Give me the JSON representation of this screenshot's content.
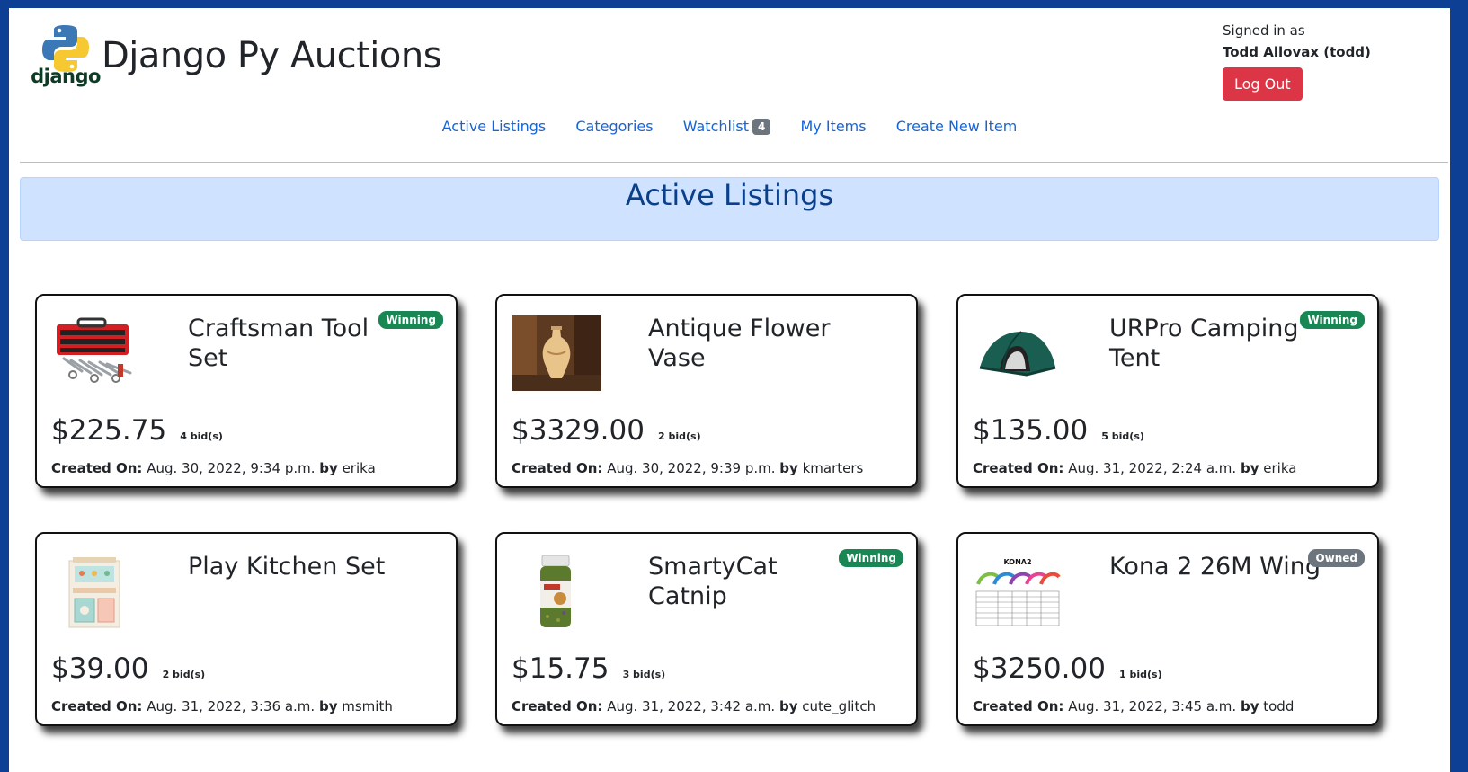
{
  "site": {
    "title": "Django Py Auctions",
    "logo_text": "django"
  },
  "user": {
    "signed_in_label": "Signed in as",
    "name": "Todd Allovax (todd)",
    "logout_label": "Log Out"
  },
  "nav": {
    "active_listings": "Active Listings",
    "categories": "Categories",
    "watchlist": "Watchlist",
    "watchlist_count": "4",
    "my_items": "My Items",
    "create_new_item": "Create New Item"
  },
  "banner": {
    "title": "Active Listings"
  },
  "labels": {
    "created_on": "Created On:",
    "by": "by"
  },
  "listings": [
    {
      "title": "Craftsman Tool Set",
      "badge": "Winning",
      "price": "$225.75",
      "bids": "4 bid(s)",
      "created": "Aug. 30, 2022, 9:34 p.m.",
      "author": "erika",
      "image": "toolbox-image"
    },
    {
      "title": "Antique Flower Vase",
      "badge": "",
      "price": "$3329.00",
      "bids": "2 bid(s)",
      "created": "Aug. 30, 2022, 9:39 p.m.",
      "author": "kmarters",
      "image": "vase-image"
    },
    {
      "title": "URPro Camping Tent",
      "badge": "Winning",
      "price": "$135.00",
      "bids": "5 bid(s)",
      "created": "Aug. 31, 2022, 2:24 a.m.",
      "author": "erika",
      "image": "tent-image"
    },
    {
      "title": "Play Kitchen Set",
      "badge": "",
      "price": "$39.00",
      "bids": "2 bid(s)",
      "created": "Aug. 31, 2022, 3:36 a.m.",
      "author": "msmith",
      "image": "play-kitchen-image"
    },
    {
      "title": "SmartyCat Catnip",
      "badge": "Winning",
      "price": "$15.75",
      "bids": "3 bid(s)",
      "created": "Aug. 31, 2022, 3:42 a.m.",
      "author": "cute_glitch",
      "image": "catnip-image"
    },
    {
      "title": "Kona 2 26M Wing",
      "badge": "Owned",
      "price": "$3250.00",
      "bids": "1 bid(s)",
      "created": "Aug. 31, 2022, 3:45 a.m.",
      "author": "todd",
      "image": "kona-wing-image",
      "image_text": "KONA2"
    }
  ],
  "colors": {
    "frame": "#0d3f94",
    "link": "#1565d8",
    "winning": "#198754",
    "owned": "#6c757d",
    "logout": "#dc3545",
    "banner_bg": "#cfe2ff"
  }
}
